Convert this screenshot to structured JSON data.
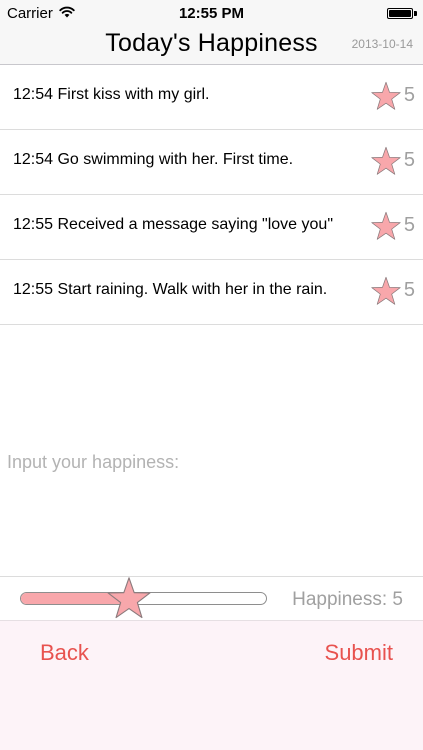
{
  "status_bar": {
    "carrier": "Carrier",
    "time": "12:55 PM",
    "wifi_icon": "wifi-icon",
    "battery_icon": "battery-icon"
  },
  "nav": {
    "title": "Today's Happiness",
    "date": "2013-10-14"
  },
  "entries": [
    {
      "text": "12:54 First kiss with my girl.",
      "score": "5",
      "icon": "star-icon"
    },
    {
      "text": "12:54 Go swimming with her. First time.",
      "score": "5",
      "icon": "star-icon"
    },
    {
      "text": "12:55 Received a message saying \"love you\"",
      "score": "5",
      "icon": "star-icon"
    },
    {
      "text": "12:55 Start raining. Walk with her in the rain.",
      "score": "5",
      "icon": "star-icon"
    }
  ],
  "input": {
    "placeholder": "Input your happiness:",
    "value": ""
  },
  "slider": {
    "label": "Happiness: 5",
    "fraction": 0.44,
    "thumb_icon": "star-icon"
  },
  "actions": {
    "back_label": "Back",
    "submit_label": "Submit"
  },
  "colors": {
    "accent": "#e8524f",
    "star_fill": "#f8a7ab",
    "muted_text": "#a0a0a0",
    "bottom_bar": "#fdf3f8"
  }
}
